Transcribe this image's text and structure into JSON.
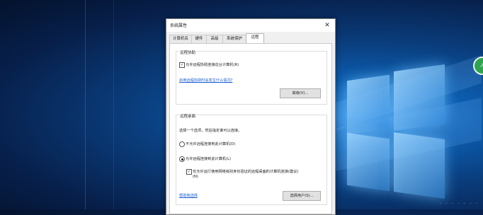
{
  "dialog": {
    "title": "系统属性",
    "close_glyph": "✕",
    "tabs": [
      "计算机名",
      "硬件",
      "高级",
      "系统保护",
      "远程"
    ],
    "active_tab": "远程",
    "remote_assistance": {
      "group_title": "远程协助",
      "allow_checkbox_label": "允许远程协助连接这台计算机(R)",
      "allow_checked": true,
      "help_link": "启用远程协助时会发生什么情况?",
      "advanced_button": "高级(V)..."
    },
    "remote_desktop": {
      "group_title": "远程桌面",
      "instruction": "选择一个选项，然后指定谁可以连接。",
      "option_deny": "不允许远程连接到此计算机(D)",
      "option_allow": "允许远程连接到此计算机(L)",
      "selected_option": "allow",
      "nla_checkbox_label": "仅允许运行使用网络级别身份验证的远程桌面的计算机连接(建议)",
      "nla_checkbox_suffix": "(N)",
      "nla_checked": true,
      "help_link": "帮助我选择",
      "select_users_button": "选择用户(S)..."
    }
  },
  "desktop": {
    "widget_text": "↗",
    "widget_color": "#2ea44f",
    "watermark": "· · · · · · ·"
  }
}
